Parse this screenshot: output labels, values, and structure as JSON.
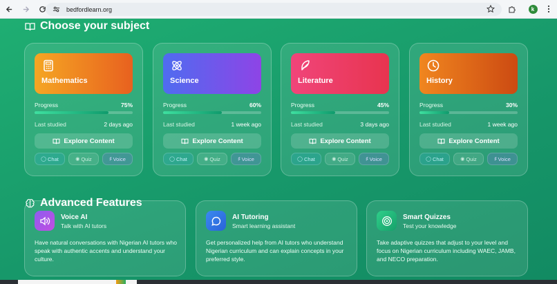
{
  "browser": {
    "url": "bedfordlearn.org",
    "profile_initial": "k"
  },
  "subjects_section": {
    "title": "Choose your subject",
    "cards": [
      {
        "name": "Mathematics",
        "icon": "calculator-icon",
        "gradient": [
          "#f5a623",
          "#e8611f"
        ],
        "progress_label": "Progress",
        "progress_text": "75%",
        "progress": 0.75,
        "last_label": "Last studied",
        "last_value": "2 days ago",
        "explore_label": "Explore Content",
        "chat_label": "Chat",
        "quiz_label": "Quiz",
        "voice_label": "Voice"
      },
      {
        "name": "Science",
        "icon": "atom-icon",
        "gradient": [
          "#4f6cf0",
          "#8e44e6"
        ],
        "progress_label": "Progress",
        "progress_text": "60%",
        "progress": 0.6,
        "last_label": "Last studied",
        "last_value": "1 week ago",
        "explore_label": "Explore Content",
        "chat_label": "Chat",
        "quiz_label": "Quiz",
        "voice_label": "Voice"
      },
      {
        "name": "Literature",
        "icon": "feather-icon",
        "gradient": [
          "#f0457a",
          "#e8344f"
        ],
        "progress_label": "Progress",
        "progress_text": "45%",
        "progress": 0.45,
        "last_label": "Last studied",
        "last_value": "3 days ago",
        "explore_label": "Explore Content",
        "chat_label": "Chat",
        "quiz_label": "Quiz",
        "voice_label": "Voice"
      },
      {
        "name": "History",
        "icon": "clock-icon",
        "gradient": [
          "#f0861f",
          "#cc4a12"
        ],
        "progress_label": "Progress",
        "progress_text": "30%",
        "progress": 0.3,
        "last_label": "Last studied",
        "last_value": "1 week ago",
        "explore_label": "Explore Content",
        "chat_label": "Chat",
        "quiz_label": "Quiz",
        "voice_label": "Voice"
      }
    ]
  },
  "features_section": {
    "title": "Advanced Features",
    "cards": [
      {
        "title": "Voice AI",
        "subtitle": "Talk with AI tutors",
        "icon": "speaker-icon",
        "icon_colors": [
          "#8e5cf0",
          "#c04fe0"
        ],
        "description": "Have natural conversations with Nigerian AI tutors who speak with authentic accents and understand your culture."
      },
      {
        "title": "AI Tutoring",
        "subtitle": "Smart learning assistant",
        "icon": "chat-bubble-icon",
        "icon_colors": [
          "#3a8af0",
          "#2a62d8"
        ],
        "description": "Get personalized help from AI tutors who understand Nigerian curriculum and can explain concepts in your preferred style."
      },
      {
        "title": "Smart Quizzes",
        "subtitle": "Test your knowledge",
        "icon": "target-icon",
        "icon_colors": [
          "#2fcf8a",
          "#16a06a"
        ],
        "description": "Take adaptive quizzes that adjust to your level and focus on Nigerian curriculum including WAEC, JAMB, and NECO preparation."
      }
    ]
  }
}
